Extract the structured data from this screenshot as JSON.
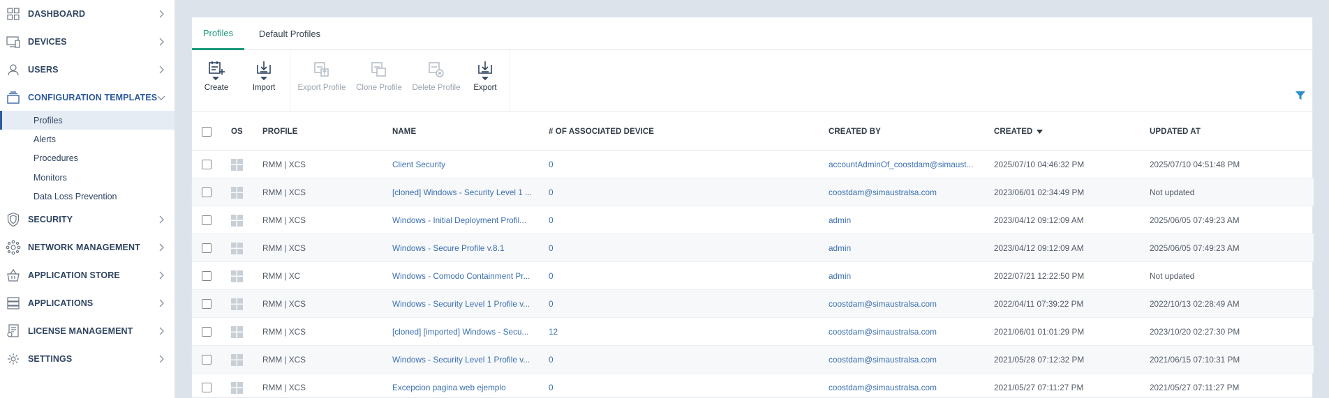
{
  "sidebar": {
    "items": [
      {
        "label": "DASHBOARD"
      },
      {
        "label": "DEVICES"
      },
      {
        "label": "USERS"
      },
      {
        "label": "CONFIGURATION TEMPLATES"
      },
      {
        "label": "SECURITY"
      },
      {
        "label": "NETWORK MANAGEMENT"
      },
      {
        "label": "APPLICATION STORE"
      },
      {
        "label": "APPLICATIONS"
      },
      {
        "label": "LICENSE MANAGEMENT"
      },
      {
        "label": "SETTINGS"
      }
    ],
    "sub_items": [
      {
        "label": "Profiles"
      },
      {
        "label": "Alerts"
      },
      {
        "label": "Procedures"
      },
      {
        "label": "Monitors"
      },
      {
        "label": "Data Loss Prevention"
      }
    ]
  },
  "tabs": [
    {
      "label": "Profiles"
    },
    {
      "label": "Default Profiles"
    }
  ],
  "toolbar": {
    "create": "Create",
    "import": "Import",
    "export_profile": "Export Profile",
    "clone_profile": "Clone Profile",
    "delete_profile": "Delete Profile",
    "export": "Export"
  },
  "table": {
    "columns": {
      "os": "OS",
      "profile": "PROFILE",
      "name": "NAME",
      "associated": "# OF ASSOCIATED DEVICE",
      "created_by": "CREATED BY",
      "created": "CREATED",
      "updated_at": "UPDATED AT"
    },
    "rows": [
      {
        "profile": "RMM | XCS",
        "name": "Client Security",
        "associated": "0",
        "created_by": "accountAdminOf_coostdam@simaust...",
        "created": "2025/07/10 04:46:32 PM",
        "updated_at": "2025/07/10 04:51:48 PM"
      },
      {
        "profile": "RMM | XCS",
        "name": "[cloned] Windows - Security Level 1 ...",
        "associated": "0",
        "created_by": "coostdam@simaustralsa.com",
        "created": "2023/06/01 02:34:49 PM",
        "updated_at": "Not updated"
      },
      {
        "profile": "RMM | XCS",
        "name": "Windows - Initial Deployment Profil...",
        "associated": "0",
        "created_by": "admin",
        "created": "2023/04/12 09:12:09 AM",
        "updated_at": "2025/06/05 07:49:23 AM"
      },
      {
        "profile": "RMM | XCS",
        "name": "Windows - Secure Profile v.8.1",
        "associated": "0",
        "created_by": "admin",
        "created": "2023/04/12 09:12:09 AM",
        "updated_at": "2025/06/05 07:49:23 AM"
      },
      {
        "profile": "RMM | XC",
        "name": "Windows - Comodo Containment Pr...",
        "associated": "0",
        "created_by": "admin",
        "created": "2022/07/21 12:22:50 PM",
        "updated_at": "Not updated"
      },
      {
        "profile": "RMM | XCS",
        "name": "Windows - Security Level 1 Profile v...",
        "associated": "0",
        "created_by": "coostdam@simaustralsa.com",
        "created": "2022/04/11 07:39:22 PM",
        "updated_at": "2022/10/13 02:28:49 AM"
      },
      {
        "profile": "RMM | XCS",
        "name": "[cloned] [imported] Windows - Secu...",
        "associated": "12",
        "created_by": "coostdam@simaustralsa.com",
        "created": "2021/06/01 01:01:29 PM",
        "updated_at": "2023/10/20 02:27:30 PM"
      },
      {
        "profile": "RMM | XCS",
        "name": "Windows - Security Level 1 Profile v...",
        "associated": "0",
        "created_by": "coostdam@simaustralsa.com",
        "created": "2021/05/28 07:12:32 PM",
        "updated_at": "2021/06/15 07:10:31 PM"
      },
      {
        "profile": "RMM | XCS",
        "name": "Excepcion pagina web ejemplo",
        "associated": "0",
        "created_by": "coostdam@simaustralsa.com",
        "created": "2021/05/27 07:11:27 PM",
        "updated_at": "2021/05/27 07:11:27 PM"
      }
    ]
  },
  "colors": {
    "accent": "#1a9a7a",
    "link": "#3a6fb0",
    "nav_text": "#2f4461",
    "filter": "#2a8fc7"
  }
}
